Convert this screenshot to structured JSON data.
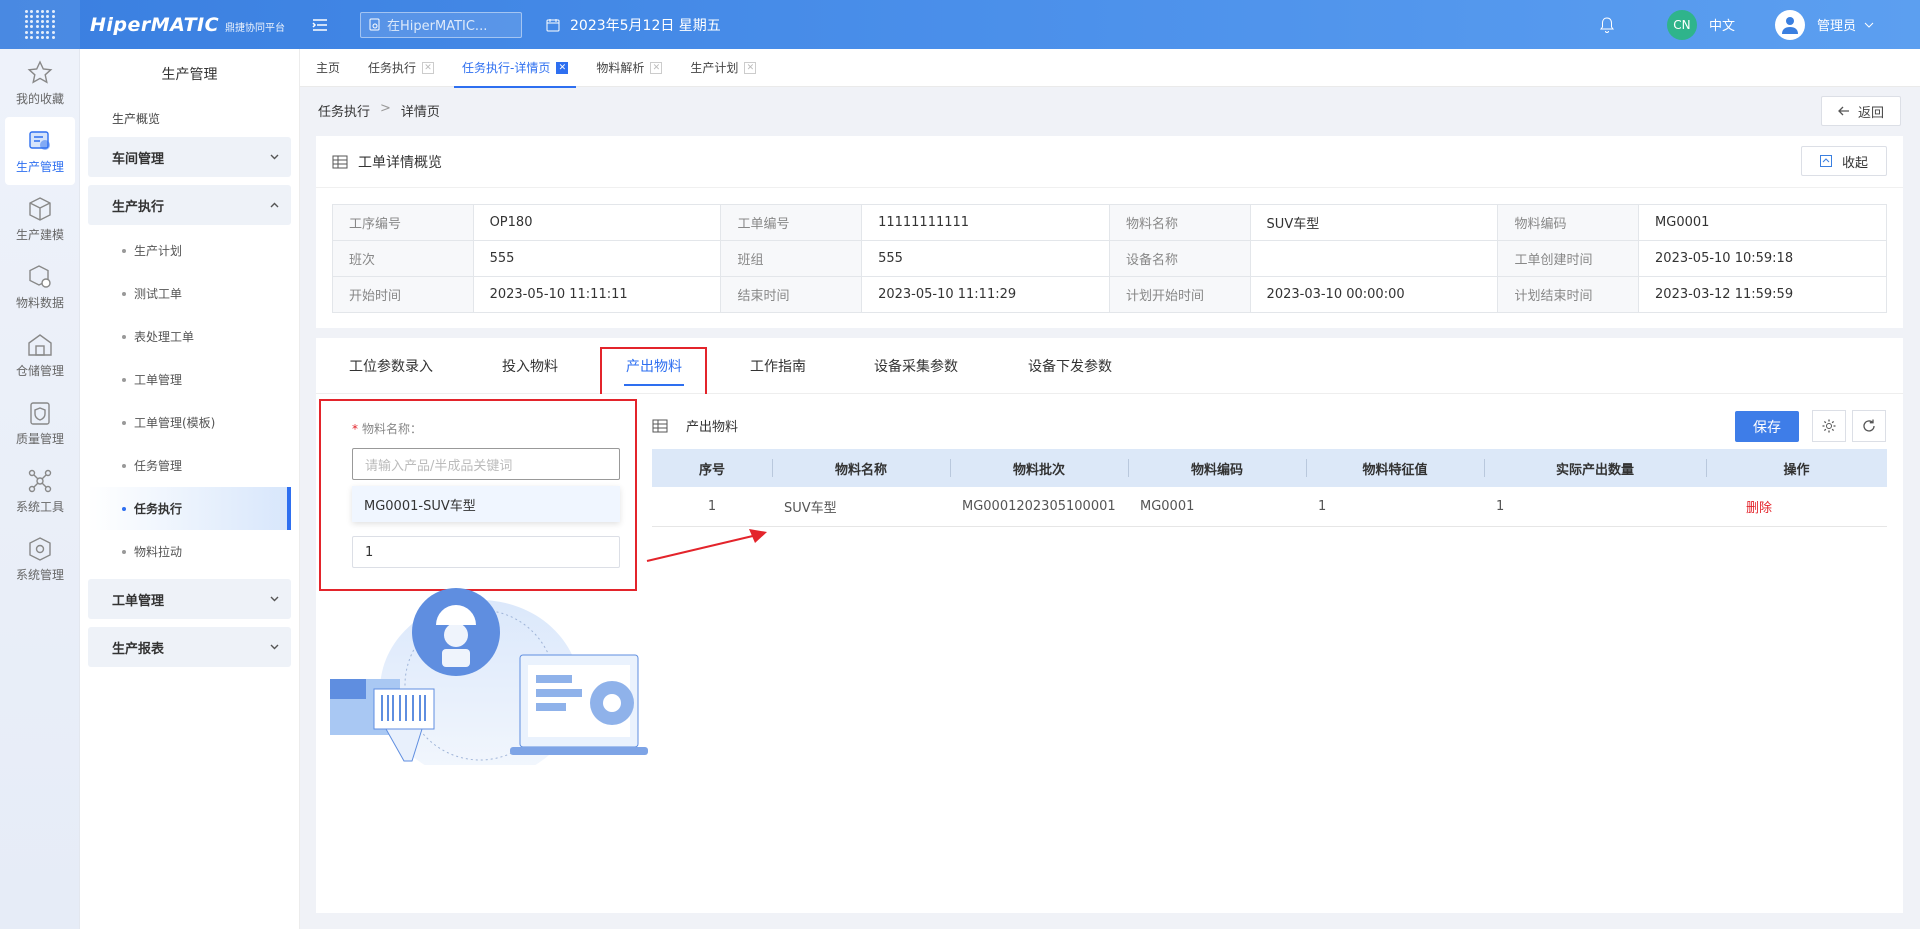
{
  "brand": {
    "name": "HiperMATIC",
    "sub": "鼎捷协同平台"
  },
  "topbar": {
    "search_placeholder": "在HiperMATIC...",
    "date": "2023年5月12日 星期五",
    "lang_badge": "CN",
    "lang": "中文",
    "user": "管理员"
  },
  "rail": [
    {
      "label": "我的收藏",
      "icon": "star-icon"
    },
    {
      "label": "生产管理",
      "icon": "production-icon"
    },
    {
      "label": "生产建模",
      "icon": "cube-icon"
    },
    {
      "label": "物料数据",
      "icon": "material-icon"
    },
    {
      "label": "仓储管理",
      "icon": "warehouse-icon"
    },
    {
      "label": "质量管理",
      "icon": "quality-icon"
    },
    {
      "label": "系统工具",
      "icon": "tools-icon"
    },
    {
      "label": "系统管理",
      "icon": "system-icon"
    }
  ],
  "sidebar": {
    "title": "生产管理",
    "overview": "生产概览",
    "group_workshop": "车间管理",
    "group_exec": "生产执行",
    "sub": [
      "生产计划",
      "测试工单",
      "表处理工单",
      "工单管理",
      "工单管理(模板)",
      "任务管理",
      "任务执行",
      "物料拉动"
    ],
    "group_order": "工单管理",
    "group_report": "生产报表"
  },
  "tabs": [
    "主页",
    "任务执行",
    "任务执行-详情页",
    "物料解析",
    "生产计划"
  ],
  "breadcrumb": {
    "parent": "任务执行",
    "sep": ">",
    "current": "详情页"
  },
  "back_label": "返回",
  "overview": {
    "title": "工单详情概览",
    "collapse_label": "收起",
    "rows": [
      [
        [
          "工序编号",
          "OP180"
        ],
        [
          "工单编号",
          "11111111111"
        ],
        [
          "物料名称",
          "SUV车型"
        ],
        [
          "物料编码",
          "MG0001"
        ]
      ],
      [
        [
          "班次",
          "555"
        ],
        [
          "班组",
          "555"
        ],
        [
          "设备名称",
          ""
        ],
        [
          "工单创建时间",
          "2023-05-10 10:59:18"
        ]
      ],
      [
        [
          "开始时间",
          "2023-05-10 11:11:11"
        ],
        [
          "结束时间",
          "2023-05-10 11:11:29"
        ],
        [
          "计划开始时间",
          "2023-03-10 00:00:00"
        ],
        [
          "计划结束时间",
          "2023-03-12 11:59:59"
        ]
      ]
    ]
  },
  "subtabs": [
    "工位参数录入",
    "投入物料",
    "产出物料",
    "工作指南",
    "设备采集参数",
    "设备下发参数"
  ],
  "form": {
    "label": "物料名称：",
    "required_mark": "*",
    "placeholder": "请输入产品/半成品关键词",
    "option": "MG0001-SUV车型",
    "qty": "1"
  },
  "output": {
    "title": "产出物料",
    "save_label": "保存",
    "columns": [
      "序号",
      "物料名称",
      "物料批次",
      "物料编码",
      "物料特征值",
      "实际产出数量",
      "操作"
    ],
    "rows": [
      [
        "1",
        "SUV车型",
        "MG0001202305100001",
        "MG0001",
        "1",
        "1",
        "删除"
      ]
    ]
  },
  "colors": {
    "primary": "#2e6ff0",
    "highlight_box": "#e3242b",
    "topbar": "#4a8fea"
  }
}
